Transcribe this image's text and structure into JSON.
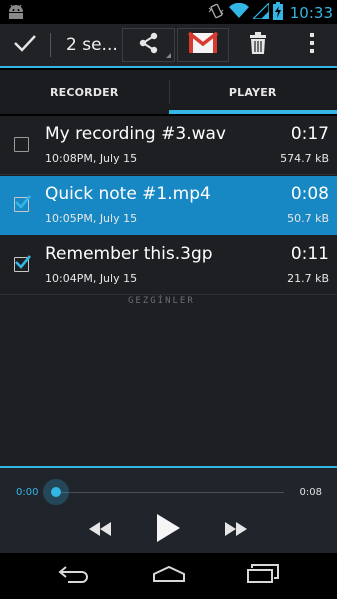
{
  "status_bar": {
    "time": "10:33",
    "icons": [
      "android-icon",
      "vibrate-icon",
      "wifi-icon",
      "signal-icon",
      "battery-charging-icon"
    ]
  },
  "action_bar": {
    "title": "2 se...",
    "actions": [
      "done-icon",
      "share-icon",
      "gmail-icon",
      "trash-icon",
      "overflow-menu-icon"
    ]
  },
  "tabs": [
    {
      "label": "RECORDER",
      "active": false
    },
    {
      "label": "PLAYER",
      "active": true
    }
  ],
  "recordings": [
    {
      "name": "My recording #3.wav",
      "date": "10:08PM, July 15",
      "duration": "0:17",
      "size": "574.7 kB",
      "checked": false,
      "highlighted": false
    },
    {
      "name": "Quick note #1.mp4",
      "date": "10:05PM, July 15",
      "duration": "0:08",
      "size": "50.7 kB",
      "checked": true,
      "highlighted": true
    },
    {
      "name": "Remember this.3gp",
      "date": "10:04PM, July 15",
      "duration": "0:11",
      "size": "21.7 kB",
      "checked": true,
      "highlighted": false
    }
  ],
  "watermark": "GEZGİNLER",
  "player": {
    "current_time": "0:00",
    "total_time": "0:08",
    "progress": 0
  },
  "colors": {
    "accent": "#33b5e5",
    "selected_row": "#1788c4",
    "list_bg": "#1d1f23",
    "action_bar_bg": "#202226"
  }
}
